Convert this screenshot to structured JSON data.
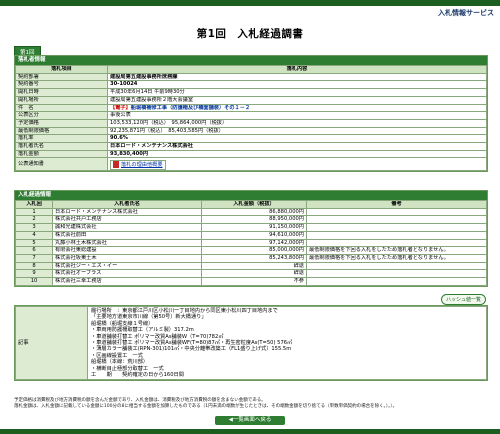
{
  "header": {
    "service": "入札情報サービス",
    "title": "第1回　入札経過調書",
    "round_badge": "第1回"
  },
  "bid_info": {
    "section_title": "落札者情報",
    "col_item": "落札項目",
    "col_content": "落札内容",
    "rows": [
      {
        "label": "契約部署",
        "value": "建設局第五建設事務所庶務課"
      },
      {
        "label": "契約番号",
        "value": "30-10024"
      },
      {
        "label": "開札日時",
        "value": "平成30年6月14日 午前9時30分"
      },
      {
        "label": "開札場所",
        "value": "建設局第五建設事務所２階大会議室"
      },
      {
        "label": "件　名",
        "tag": "【電子】",
        "value": "船堀橋補修工事（防護柵及び橋面舗装）その１－２"
      },
      {
        "label": "公表区分",
        "value": "事後公表"
      },
      {
        "label": "予定価格",
        "value": "103,533,120円（税込）　95,864,000円（税抜）"
      },
      {
        "label": "最低制限価格",
        "value": "92,235,871円（税込）　85,403,585円（税抜）"
      },
      {
        "label": "落札率",
        "value": "90.6%"
      },
      {
        "label": "落札者氏名",
        "value": "日本ロード・メンテナンス株式会社"
      },
      {
        "label": "落札金額",
        "value": "93,830,400円"
      }
    ],
    "pdf_label": "公表通知書",
    "pdf_link": "落札の理由他概要"
  },
  "bid_progress": {
    "section_title": "入札経過情報",
    "columns": [
      "入札回",
      "入札者氏名",
      "入札金額（税抜）",
      "備考"
    ],
    "rows": [
      {
        "no": "1",
        "name": "日本ロード・メンテナンス株式会社",
        "amount": "86,880,000円",
        "note": ""
      },
      {
        "no": "2",
        "name": "株式会社共戸工務店",
        "amount": "88,950,000円",
        "note": ""
      },
      {
        "no": "3",
        "name": "誠和光建株式会社",
        "amount": "91,150,000円",
        "note": ""
      },
      {
        "no": "4",
        "name": "株式会社前田",
        "amount": "94,610,000円",
        "note": ""
      },
      {
        "no": "5",
        "name": "丸藤小林土木株式会社",
        "amount": "97,142,000円",
        "note": ""
      },
      {
        "no": "6",
        "name": "有限会社東総建設",
        "amount": "85,000,000円",
        "note": "最低制限価格を下回る入札をしたため落札者となりません。"
      },
      {
        "no": "7",
        "name": "株式会社坂東土木",
        "amount": "85,243,800円",
        "note": "最低制限価格を下回る入札をしたため落札者となりません。"
      },
      {
        "no": "8",
        "name": "株式会社ジー・エス・イー",
        "amount": "辞退",
        "note": ""
      },
      {
        "no": "9",
        "name": "株式会社オーブラス",
        "amount": "辞退",
        "note": ""
      },
      {
        "no": "10",
        "name": "株式会社三幸工務店",
        "amount": "不参",
        "note": ""
      }
    ],
    "hash_button": "ハッシュ値一覧"
  },
  "memo": {
    "label": "記事",
    "lines": [
      "履行場所　：東京都江戸川区小松川一丁目地内から同区東小松川四丁目地内まで",
      "「主要地方道東京市川線（第50号）新大橋通り」",
      "船堀橋（船堀支線１号線）",
      "・車両用防護柵取替工（アルミ製）317.2m",
      "・車道舗装打替工 ポリマー改質As舗装W（T=70)782㎡",
      "・車道舗装打替工 ポリマー改質As舗装WF(T=80)87㎡・再生密粒度As(T=50) 576㎡",
      "・薄層カラー舗装工(RPN-301)101㎡・中央分離帯改築工（FL1盛り上げ式）155.5m",
      "・区画線設置工　一式",
      "船堀橋（本線：荒川部）",
      "・横断目止極部分取替工　一式",
      "工　　期　　契約確定の日から160日間"
    ]
  },
  "notes": {
    "line1": "予定価格は消費税及び地方消費税の額を含んだ金額であり、入札金額は、消費税及び地方消費税の額を含まない金額である。",
    "line2": "落札金額は、入札金額に記載している金額に100分の8に相当する金額を加算したものである（1円未満の端数が生じたときは、その端数金額を切り捨てる（単数単価契約の場合を除く。）。）。"
  },
  "back_button": "◀一覧画面へ戻る"
}
